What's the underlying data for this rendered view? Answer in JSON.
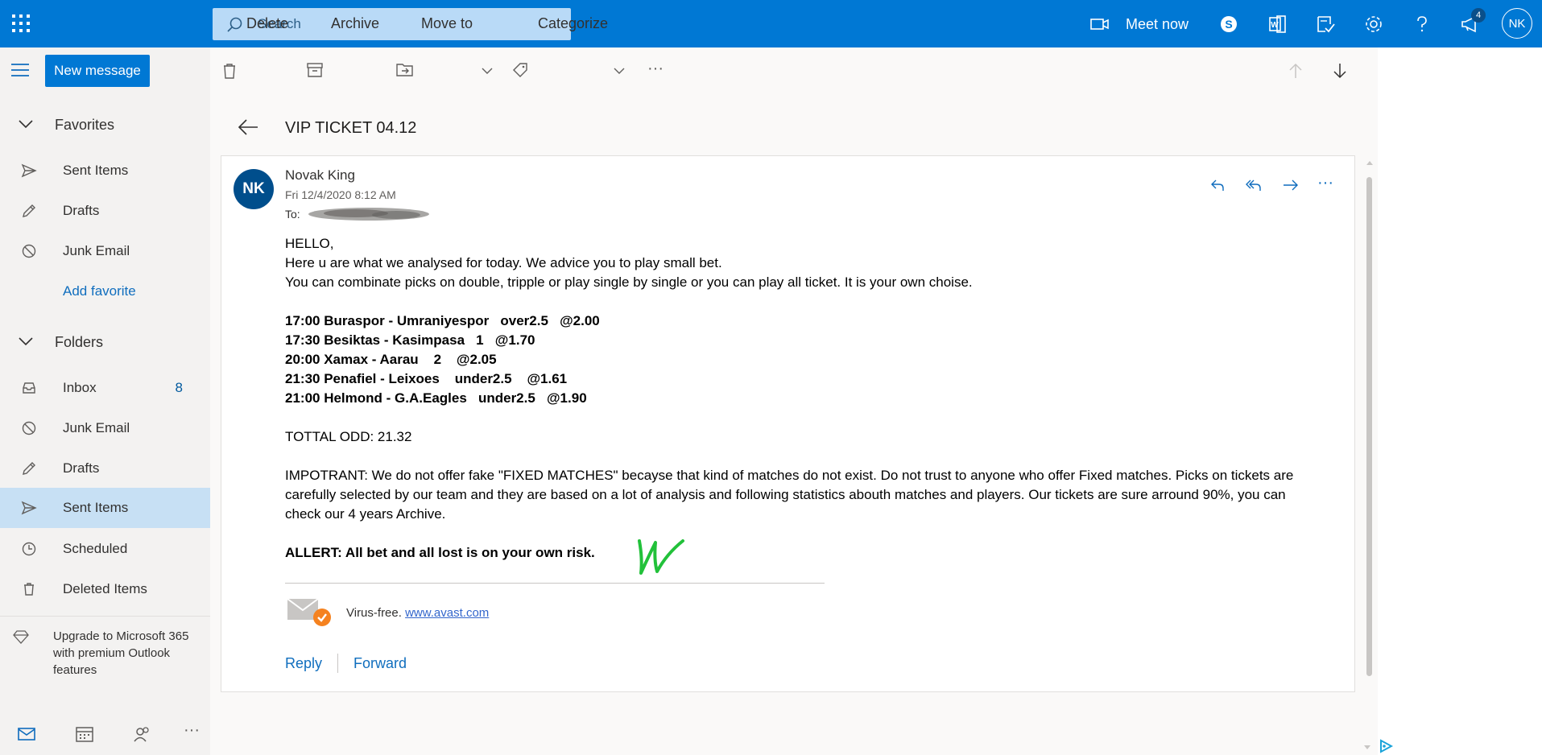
{
  "header": {
    "search_placeholder": "Search",
    "meet_now": "Meet now",
    "notification_count": "4",
    "user_initials": "NK"
  },
  "sidebar": {
    "new_message": "New message",
    "favorites_label": "Favorites",
    "favorites": [
      {
        "label": "Sent Items",
        "icon": "send-icon"
      },
      {
        "label": "Drafts",
        "icon": "pencil-icon"
      },
      {
        "label": "Junk Email",
        "icon": "block-icon"
      }
    ],
    "add_favorite": "Add favorite",
    "folders_label": "Folders",
    "folders": [
      {
        "label": "Inbox",
        "icon": "inbox-icon",
        "count": "8"
      },
      {
        "label": "Junk Email",
        "icon": "block-icon"
      },
      {
        "label": "Drafts",
        "icon": "pencil-icon"
      },
      {
        "label": "Sent Items",
        "icon": "send-icon",
        "selected": true
      },
      {
        "label": "Scheduled",
        "icon": "clock-icon"
      },
      {
        "label": "Deleted Items",
        "icon": "trash-icon"
      }
    ],
    "upgrade_text": "Upgrade to Microsoft 365 with premium Outlook features"
  },
  "toolbar": {
    "delete": "Delete",
    "archive": "Archive",
    "move_to": "Move to",
    "categorize": "Categorize",
    "more": "···"
  },
  "message": {
    "subject": "VIP TICKET 04.12",
    "sender_initials": "NK",
    "sender": "Novak King",
    "date": "Fri 12/4/2020 8:12 AM",
    "to_label": "To:",
    "greeting": "HELLO,",
    "line1": "Here u are what we analysed for today. We advice you to play small bet.",
    "line2": "You can combinate picks on double, tripple or play single by single or you can play all ticket. It is your own choise.",
    "picks": [
      "17:00 Buraspor - Umraniyespor   over2.5   @2.00",
      "17:30 Besiktas - Kasimpasa   1   @1.70",
      "20:00 Xamax - Aarau    2    @2.05",
      "21:30 Penafiel - Leixoes    under2.5    @1.61",
      "21:00 Helmond - G.A.Eagles   under2.5   @1.90"
    ],
    "total_odd": "TOTTAL ODD: 21.32",
    "important": "IMPOTRANT: We do not offer fake \"FIXED MATCHES\" becayse that kind of matches do not exist. Do not trust to anyone who offer Fixed matches. Picks on tickets are carefully selected by our team and they are based on a lot of analysis and following statistics abouth matches and players. Our tickets are sure arround 90%, you can check our 4 years Archive.",
    "alert": "ALLERT: All bet and all lost is on your own risk.",
    "virus_free": "Virus-free.",
    "avast_link": "www.avast.com",
    "reply": "Reply",
    "forward": "Forward"
  }
}
